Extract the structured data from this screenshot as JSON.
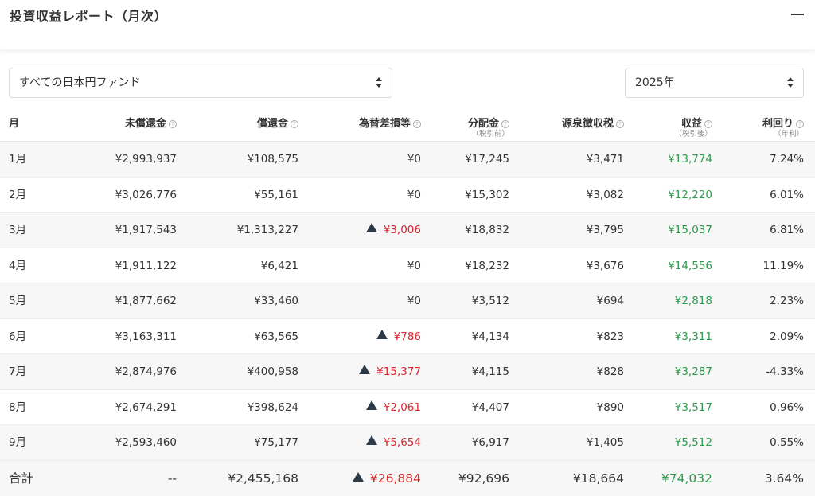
{
  "header": {
    "title": "投資収益レポート（月次）"
  },
  "filters": {
    "fund": "すべての日本円ファンド",
    "year": "2025年"
  },
  "colors": {
    "gain": "#2e9a4c",
    "loss": "#d9272e",
    "triangle": "#2c3a47"
  },
  "table": {
    "columns": [
      {
        "label": "月",
        "sub": ""
      },
      {
        "label": "未償還金",
        "sub": ""
      },
      {
        "label": "償還金",
        "sub": ""
      },
      {
        "label": "為替差損等",
        "sub": ""
      },
      {
        "label": "分配金",
        "sub": "（税引前）"
      },
      {
        "label": "源泉徴収税",
        "sub": ""
      },
      {
        "label": "収益",
        "sub": "（税引後）"
      },
      {
        "label": "利回り",
        "sub": "（年利）"
      }
    ],
    "rows": [
      {
        "month": "1月",
        "outstanding": "¥2,993,937",
        "redemption": "¥108,575",
        "fx": "¥0",
        "fx_loss": false,
        "distribution": "¥17,245",
        "tax": "¥3,471",
        "profit": "¥13,774",
        "yield": "7.24%"
      },
      {
        "month": "2月",
        "outstanding": "¥3,026,776",
        "redemption": "¥55,161",
        "fx": "¥0",
        "fx_loss": false,
        "distribution": "¥15,302",
        "tax": "¥3,082",
        "profit": "¥12,220",
        "yield": "6.01%"
      },
      {
        "month": "3月",
        "outstanding": "¥1,917,543",
        "redemption": "¥1,313,227",
        "fx": "¥3,006",
        "fx_loss": true,
        "distribution": "¥18,832",
        "tax": "¥3,795",
        "profit": "¥15,037",
        "yield": "6.81%"
      },
      {
        "month": "4月",
        "outstanding": "¥1,911,122",
        "redemption": "¥6,421",
        "fx": "¥0",
        "fx_loss": false,
        "distribution": "¥18,232",
        "tax": "¥3,676",
        "profit": "¥14,556",
        "yield": "11.19%"
      },
      {
        "month": "5月",
        "outstanding": "¥1,877,662",
        "redemption": "¥33,460",
        "fx": "¥0",
        "fx_loss": false,
        "distribution": "¥3,512",
        "tax": "¥694",
        "profit": "¥2,818",
        "yield": "2.23%"
      },
      {
        "month": "6月",
        "outstanding": "¥3,163,311",
        "redemption": "¥63,565",
        "fx": "¥786",
        "fx_loss": true,
        "distribution": "¥4,134",
        "tax": "¥823",
        "profit": "¥3,311",
        "yield": "2.09%"
      },
      {
        "month": "7月",
        "outstanding": "¥2,874,976",
        "redemption": "¥400,958",
        "fx": "¥15,377",
        "fx_loss": true,
        "distribution": "¥4,115",
        "tax": "¥828",
        "profit": "¥3,287",
        "yield": "-4.33%"
      },
      {
        "month": "8月",
        "outstanding": "¥2,674,291",
        "redemption": "¥398,624",
        "fx": "¥2,061",
        "fx_loss": true,
        "distribution": "¥4,407",
        "tax": "¥890",
        "profit": "¥3,517",
        "yield": "0.96%"
      },
      {
        "month": "9月",
        "outstanding": "¥2,593,460",
        "redemption": "¥75,177",
        "fx": "¥5,654",
        "fx_loss": true,
        "distribution": "¥6,917",
        "tax": "¥1,405",
        "profit": "¥5,512",
        "yield": "0.55%"
      }
    ],
    "total": {
      "label": "合計",
      "outstanding": "--",
      "redemption": "¥2,455,168",
      "fx": "¥26,884",
      "fx_loss": true,
      "distribution": "¥92,696",
      "tax": "¥18,664",
      "profit": "¥74,032",
      "yield": "3.64%"
    }
  }
}
